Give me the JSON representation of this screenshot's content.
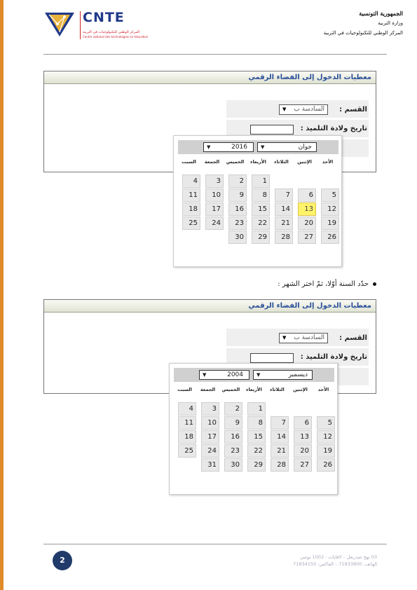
{
  "header": {
    "logo_title": "CNTE",
    "logo_subtitle_ar": "المركز الوطني للتكنولوجيات في التربية",
    "logo_subtitle_fr": "Centre national des technologies en éducation",
    "republic": "الجمهورية التونسية",
    "ministry": "وزارة التربية",
    "center": "المركز الوطني للتكنولوجيات في التربية"
  },
  "panels": [
    {
      "title": "معطيات الدخول إلى الفضاء الرقمي",
      "class_label": "القسم :",
      "class_value": "السادسة ب",
      "dob_label": "تاريخ ولادة التلميذ :",
      "calendar": {
        "month": "جوان",
        "year": "2016",
        "weekdays": [
          "الأحد",
          "الإثنين",
          "الثلاثاء",
          "الأربعاء",
          "الخميس",
          "الجمعة",
          "السبت"
        ],
        "weeks": [
          [
            "",
            "",
            "",
            "1",
            "2",
            "3",
            "4"
          ],
          [
            "5",
            "6",
            "7",
            "8",
            "9",
            "10",
            "11"
          ],
          [
            "12",
            "13",
            "14",
            "15",
            "16",
            "17",
            "18"
          ],
          [
            "19",
            "20",
            "21",
            "22",
            "23",
            "24",
            "25"
          ],
          [
            "26",
            "27",
            "28",
            "29",
            "30",
            "",
            ""
          ]
        ],
        "highlighted": "13"
      }
    },
    {
      "title": "معطيات الدخول إلى الفضاء الرقمي",
      "class_label": "القسم :",
      "class_value": "السادسة ب",
      "dob_label": "تاريخ ولادة التلميذ :",
      "calendar": {
        "month": "ديسمبر",
        "year": "2004",
        "weekdays": [
          "الأحد",
          "الإثنين",
          "الثلاثاء",
          "الأربعاء",
          "الخميس",
          "الجمعة",
          "السبت"
        ],
        "weeks": [
          [
            "",
            "",
            "",
            "1",
            "2",
            "3",
            "4"
          ],
          [
            "5",
            "6",
            "7",
            "8",
            "9",
            "10",
            "11"
          ],
          [
            "12",
            "13",
            "14",
            "15",
            "16",
            "17",
            "18"
          ],
          [
            "19",
            "20",
            "21",
            "22",
            "23",
            "24",
            "25"
          ],
          [
            "26",
            "27",
            "28",
            "29",
            "30",
            "31",
            ""
          ]
        ],
        "highlighted": ""
      }
    }
  ],
  "instruction": "حدّد السنة أوّلا، ثمّ اختر الشهر :",
  "footer": {
    "page_number": "2",
    "address_line1": "03 نهج صدربعل – لافايات - 1002 تونس",
    "address_line2": "الهاتف: 71833800 – الفاكس: 71834150"
  },
  "colors": {
    "accent": "#e08a2a",
    "title_blue": "#2a4f9a",
    "highlight": "#fff36a",
    "page_badge": "#203a6a"
  },
  "icons": [
    "cnte-logo-icon",
    "dropdown-arrow-icon"
  ]
}
